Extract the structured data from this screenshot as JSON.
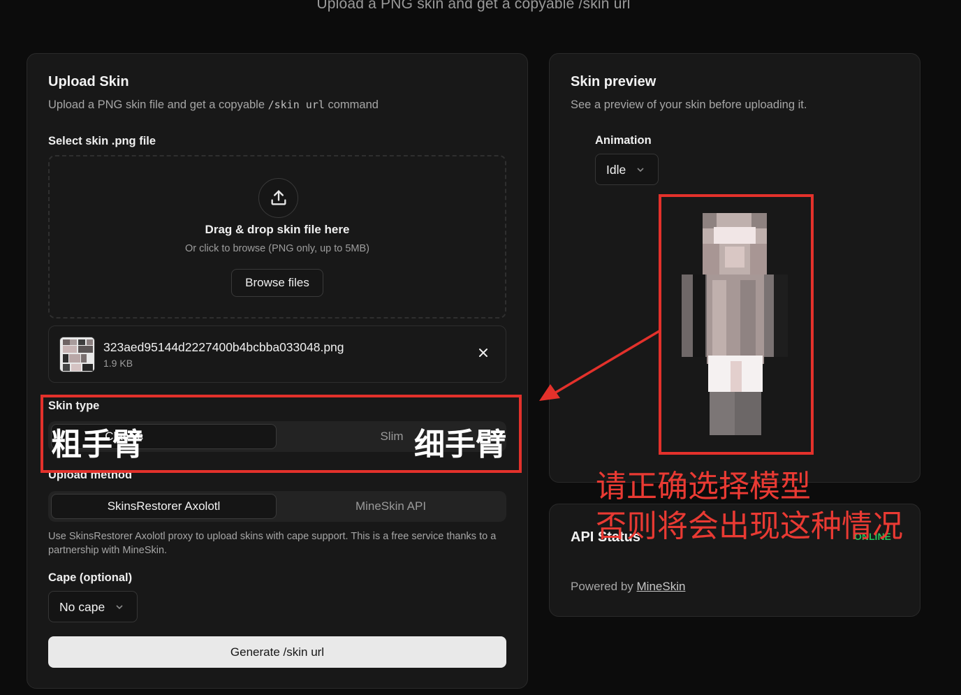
{
  "header": {
    "subtitle": "Upload a PNG skin and get a copyable /skin url"
  },
  "upload_card": {
    "title": "Upload Skin",
    "desc_pre": "Upload a PNG skin file and get a copyable",
    "desc_code": "/skin url",
    "desc_post": "command",
    "file_label": "Select skin .png file",
    "dropzone": {
      "icon": "upload-icon",
      "title": "Drag & drop skin file here",
      "subtitle": "Or click to browse (PNG only, up to 5MB)",
      "browse_label": "Browse files"
    },
    "selected_file": {
      "name": "323aed95144d2227400b4bcbba033048.png",
      "size": "1.9 KB",
      "remove_icon": "close-icon"
    },
    "skin_type": {
      "label": "Skin type",
      "options": [
        "Classic",
        "Slim"
      ],
      "selected": "Classic"
    },
    "upload_method": {
      "label": "Upload method",
      "options": [
        "SkinsRestorer Axolotl",
        "MineSkin API"
      ],
      "selected": "SkinsRestorer Axolotl",
      "help": "Use SkinsRestorer Axolotl proxy to upload skins with cape support. This is a free service thanks to a partnership with MineSkin."
    },
    "cape": {
      "label": "Cape (optional)",
      "value": "No cape"
    },
    "generate_label": "Generate /skin url"
  },
  "preview_card": {
    "title": "Skin preview",
    "desc": "See a preview of your skin before uploading it.",
    "animation_label": "Animation",
    "animation_value": "Idle"
  },
  "api_card": {
    "title": "API Status",
    "status": "ONLINE",
    "powered_prefix": "Powered by",
    "powered_link": "MineSkin"
  },
  "annotations": {
    "classic_note": "粗手臂",
    "slim_note": "细手臂",
    "warning_line1": "请正确选择模型",
    "warning_line2": "否则将会出现这种情况"
  },
  "colors": {
    "background": "#0c0c0c",
    "card": "#181818",
    "annotation_red": "#e3312b",
    "status_green": "#21c35a"
  }
}
